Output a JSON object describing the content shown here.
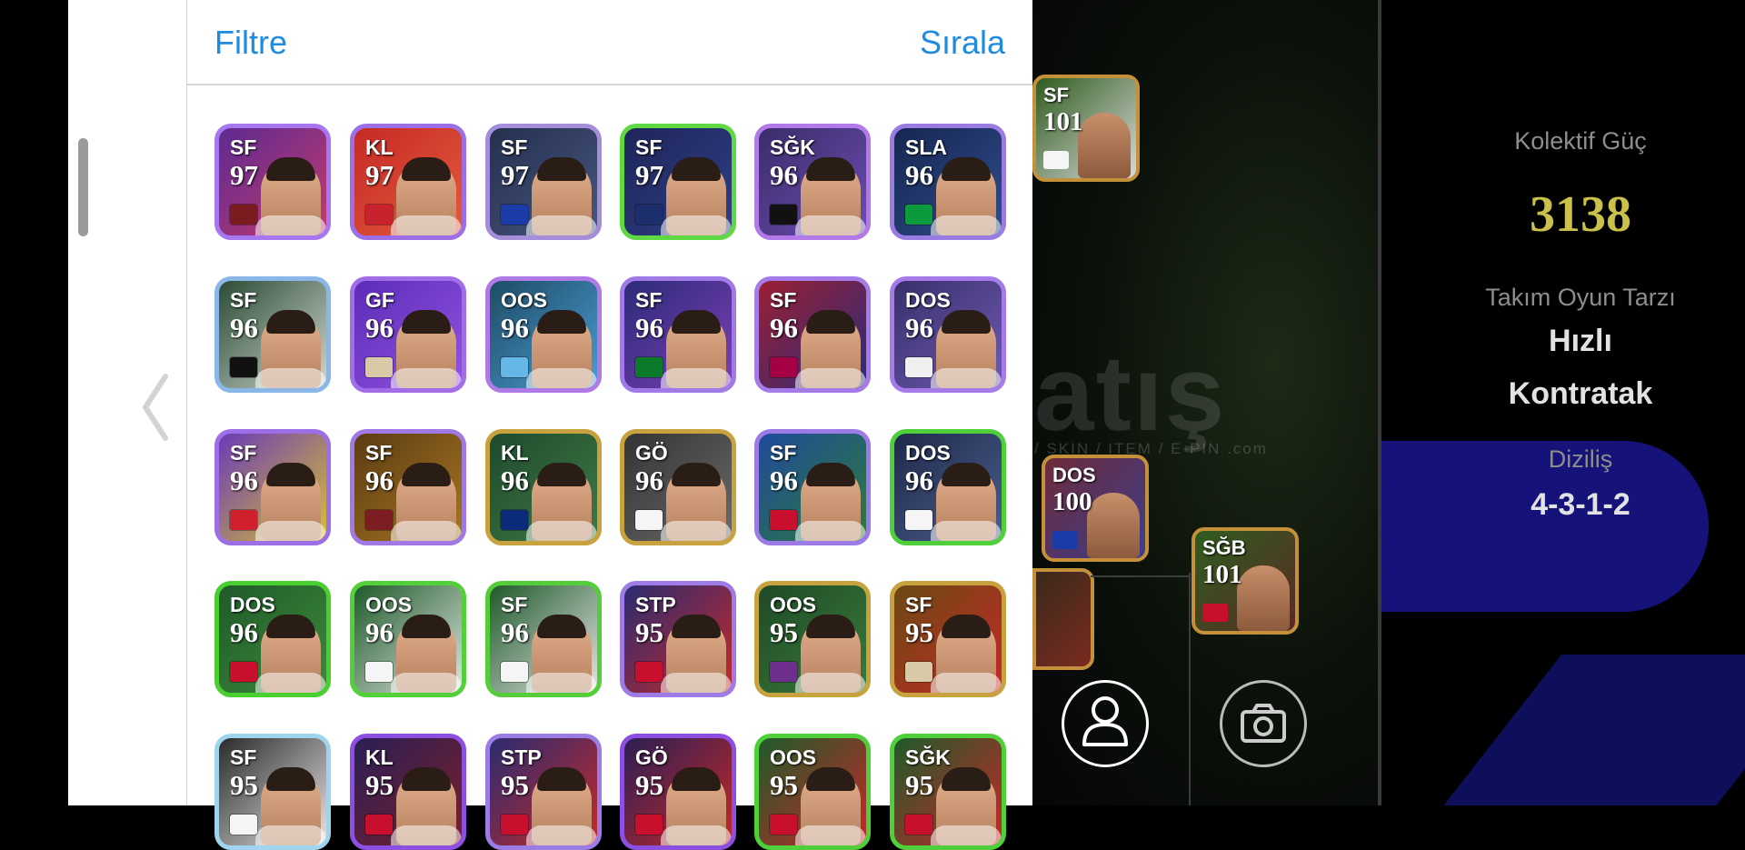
{
  "header": {
    "filter_label": "Filtre",
    "sort_label": "Sırala"
  },
  "cards": [
    {
      "pos": "SF",
      "rating": "97",
      "border": "#a777f0",
      "bg": "#5d2a91",
      "bg2": "#c43a6d",
      "emblem": "#7a1b20"
    },
    {
      "pos": "KL",
      "rating": "97",
      "border": "#9d6fe6",
      "bg": "#c52a25",
      "bg2": "#e45a3d",
      "emblem": "#c8232d"
    },
    {
      "pos": "SF",
      "rating": "97",
      "border": "#a58ed9",
      "bg": "#25304f",
      "bg2": "#47567f",
      "emblem": "#1b3ca8"
    },
    {
      "pos": "SF",
      "rating": "97",
      "border": "#5ed843",
      "bg": "#1e255a",
      "bg2": "#2f3f85",
      "emblem": "#1c2e6b"
    },
    {
      "pos": "SĞK",
      "rating": "96",
      "border": "#b17ae8",
      "bg": "#3a2d6b",
      "bg2": "#6e4bb0",
      "emblem": "#111"
    },
    {
      "pos": "SLA",
      "rating": "96",
      "border": "#9a7be2",
      "bg": "#162650",
      "bg2": "#2f4d8c",
      "emblem": "#0b9a3c"
    },
    {
      "pos": "SF",
      "rating": "96",
      "border": "#8ab7e8",
      "bg": "#2b4b34",
      "bg2": "#cfd7d0",
      "emblem": "#111"
    },
    {
      "pos": "GF",
      "rating": "96",
      "border": "#a16ee8",
      "bg": "#5b2cb8",
      "bg2": "#9254e0",
      "emblem": "#d9c9a7"
    },
    {
      "pos": "OOS",
      "rating": "96",
      "border": "#b07ae6",
      "bg": "#1e4c66",
      "bg2": "#4a9bd0",
      "emblem": "#67b6e8"
    },
    {
      "pos": "SF",
      "rating": "96",
      "border": "#a07ae6",
      "bg": "#2c2b78",
      "bg2": "#7c3fb6",
      "emblem": "#0b7a2b"
    },
    {
      "pos": "SF",
      "rating": "96",
      "border": "#a47be8",
      "bg": "#9b1f32",
      "bg2": "#2a2c7c",
      "emblem": "#a50044"
    },
    {
      "pos": "DOS",
      "rating": "96",
      "border": "#a47be8",
      "bg": "#3a2f6b",
      "bg2": "#6d5ab2",
      "emblem": "#f0f0f0"
    },
    {
      "pos": "SF",
      "rating": "96",
      "border": "#9d6fe6",
      "bg": "#6a3ab8",
      "bg2": "#d8c032",
      "emblem": "#d0202e"
    },
    {
      "pos": "SF",
      "rating": "96",
      "border": "#a079e4",
      "bg": "#5b3b13",
      "bg2": "#a6761f",
      "emblem": "#7d1c22"
    },
    {
      "pos": "KL",
      "rating": "96",
      "border": "#c8a23e",
      "bg": "#1e4a2c",
      "bg2": "#3f7a46",
      "emblem": "#0a2b7a"
    },
    {
      "pos": "GÖ",
      "rating": "96",
      "border": "#c8a23e",
      "bg": "#343434",
      "bg2": "#6a6a6a",
      "emblem": "#f5f5f5"
    },
    {
      "pos": "SF",
      "rating": "96",
      "border": "#9d7be6",
      "bg": "#1f4a9a",
      "bg2": "#2e7b3c",
      "emblem": "#c8102e"
    },
    {
      "pos": "DOS",
      "rating": "96",
      "border": "#4fcf3a",
      "bg": "#1f2a4a",
      "bg2": "#4a5d8c",
      "emblem": "#f5f5f5"
    },
    {
      "pos": "DOS",
      "rating": "96",
      "border": "#49cf2f",
      "bg": "#1f5a2a",
      "bg2": "#3e8a3a",
      "emblem": "#c8102e"
    },
    {
      "pos": "OOS",
      "rating": "96",
      "border": "#53cf3a",
      "bg": "#1f5a2a",
      "bg2": "#dfe5df",
      "emblem": "#f5f5f5"
    },
    {
      "pos": "SF",
      "rating": "96",
      "border": "#55cd3b",
      "bg": "#1f5a2a",
      "bg2": "#e4e4e4",
      "emblem": "#f5f5f5"
    },
    {
      "pos": "STP",
      "rating": "95",
      "border": "#9f7be6",
      "bg": "#2a2b70",
      "bg2": "#c62a2a",
      "emblem": "#c8102e"
    },
    {
      "pos": "OOS",
      "rating": "95",
      "border": "#c8a23e",
      "bg": "#1f4a26",
      "bg2": "#3a7a3a",
      "emblem": "#6e2f8c"
    },
    {
      "pos": "SF",
      "rating": "95",
      "border": "#c8a23e",
      "bg": "#6a4a12",
      "bg2": "#c62828",
      "emblem": "#d9c9a7"
    },
    {
      "pos": "SF",
      "rating": "95",
      "border": "#9fd4ee",
      "bg": "#2a2a2a",
      "bg2": "#e6e6e6",
      "emblem": "#f5f5f5"
    },
    {
      "pos": "KL",
      "rating": "95",
      "border": "#8c4fe2",
      "bg": "#2a1f55",
      "bg2": "#7a1f2a",
      "emblem": "#c8102e"
    },
    {
      "pos": "STP",
      "rating": "95",
      "border": "#9b7be4",
      "bg": "#2a2b70",
      "bg2": "#c62a2a",
      "emblem": "#c8102e"
    },
    {
      "pos": "GÖ",
      "rating": "95",
      "border": "#8c4fe2",
      "bg": "#2a1f55",
      "bg2": "#c62828",
      "emblem": "#c8102e"
    },
    {
      "pos": "OOS",
      "rating": "95",
      "border": "#4fcf3a",
      "bg": "#1f5a2a",
      "bg2": "#c62828",
      "emblem": "#c8102e"
    },
    {
      "pos": "SĞK",
      "rating": "95",
      "border": "#4fcf3a",
      "bg": "#1f5a2a",
      "bg2": "#c62828",
      "emblem": "#c8102e"
    }
  ],
  "pitch_cards": [
    {
      "pos": "SF",
      "rating": "101",
      "bg": "#2f5c1f",
      "bg2": "#d9d9d9",
      "emblem": "#f5f5f5"
    },
    {
      "pos": "DOS",
      "rating": "100",
      "bg": "#6e2a3a",
      "bg2": "#3a3f8c",
      "emblem": "#1b3ca8"
    },
    {
      "pos": "SĞB",
      "rating": "101",
      "bg": "#2f5c1f",
      "bg2": "#5a2a24",
      "emblem": "#c8102e"
    }
  ],
  "watermark": {
    "main": "atış",
    "sub": "/ SKIN / ITEM / E-PIN .com"
  },
  "stats": {
    "power_label": "Kolektif Güç",
    "power_value": "3138",
    "style_label": "Takım Oyun Tarzı",
    "style_value_line1": "Hızlı",
    "style_value_line2": "Kontratak",
    "formation_label": "Diziliş",
    "formation_value": "4-3-1-2"
  },
  "icons": {
    "profile": "person-icon",
    "camera": "camera-icon",
    "back": "chevron-left-icon"
  }
}
